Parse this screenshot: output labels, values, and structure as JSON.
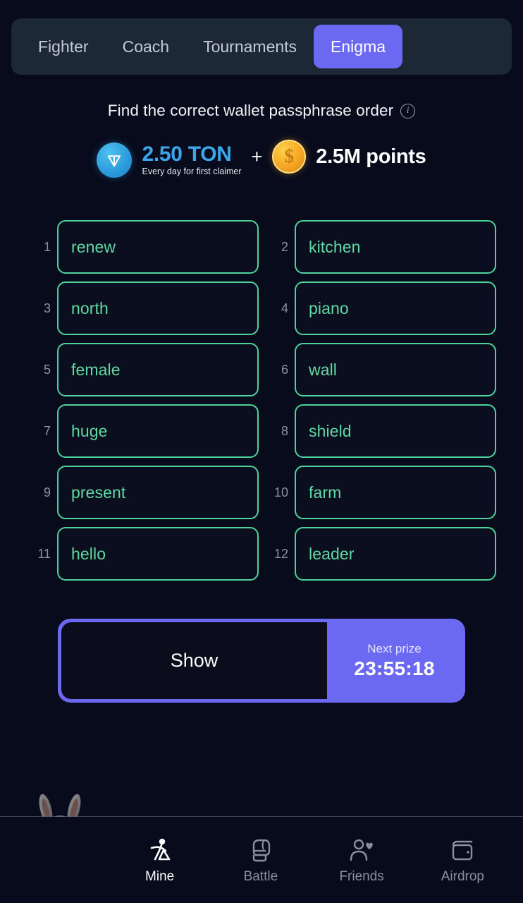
{
  "theme": {
    "background": "#080b1c",
    "tabbar_bg": "#1d2836",
    "accent_purple": "#6b68f2",
    "word_green": "#4ed39a",
    "ton_blue": "#3ba6ec",
    "coin_gold": "#f5a623",
    "muted_text": "#8a93a3"
  },
  "tabs": [
    {
      "label": "Fighter",
      "active": false,
      "name": "tab-fighter"
    },
    {
      "label": "Coach",
      "active": false,
      "name": "tab-coach"
    },
    {
      "label": "Tournaments",
      "active": false,
      "name": "tab-tournaments"
    },
    {
      "label": "Enigma",
      "active": true,
      "name": "tab-enigma"
    }
  ],
  "header": {
    "title": "Find the correct wallet passphrase order",
    "info_icon": "info-circle-icon",
    "info_glyph": "i"
  },
  "prize": {
    "ton_icon": "ton-coin-icon",
    "ton_amount": "2.50 TON",
    "ton_subtitle": "Every day for first claimer",
    "plus": "+",
    "coin_icon": "dollar-coin-icon",
    "coin_glyph": "$",
    "points_amount": "2.5M points"
  },
  "passphrase": {
    "words": [
      {
        "num": "1",
        "word": "renew"
      },
      {
        "num": "2",
        "word": "kitchen"
      },
      {
        "num": "3",
        "word": "north"
      },
      {
        "num": "4",
        "word": "piano"
      },
      {
        "num": "5",
        "word": "female"
      },
      {
        "num": "6",
        "word": "wall"
      },
      {
        "num": "7",
        "word": "huge"
      },
      {
        "num": "8",
        "word": "shield"
      },
      {
        "num": "9",
        "word": "present"
      },
      {
        "num": "10",
        "word": "farm"
      },
      {
        "num": "11",
        "word": "hello"
      },
      {
        "num": "12",
        "word": "leader"
      }
    ]
  },
  "action": {
    "show_label": "Show",
    "next_prize_label": "Next prize",
    "timer": "23:55:18"
  },
  "mascot": {
    "name": "rabbit-fighter-mascot"
  },
  "bottom_nav": [
    {
      "label": "Mine",
      "icon": "pickaxe-miner-icon",
      "active": true,
      "name": "nav-item-mine"
    },
    {
      "label": "Battle",
      "icon": "boxing-glove-icon",
      "active": false,
      "name": "nav-item-battle"
    },
    {
      "label": "Friends",
      "icon": "person-heart-icon",
      "active": false,
      "name": "nav-item-friends"
    },
    {
      "label": "Airdrop",
      "icon": "wallet-icon",
      "active": false,
      "name": "nav-item-airdrop"
    }
  ]
}
